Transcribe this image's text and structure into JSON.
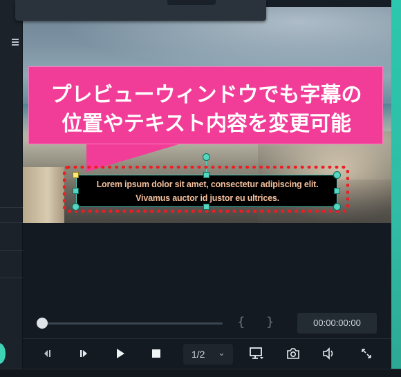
{
  "callout": {
    "line1": "プレビューウィンドウでも字幕の",
    "line2": "位置やテキスト内容を変更可能"
  },
  "subtitle": {
    "line1": "Lorem ipsum dolor sit amet, consectetur adipiscing elit.",
    "line2": "Vivamus auctor id justor eu ultrices."
  },
  "playback": {
    "mark_in": "{",
    "mark_out": "}",
    "timecode": "00:00:00:00",
    "progress": 0,
    "page": "1/2"
  },
  "colors": {
    "callout_bg": "#f23d98",
    "highlight_border": "#ee1c24",
    "handle": "#54d6c1",
    "subtitle_text": "#f6c09d",
    "accent": "#3fd3b6"
  },
  "icons": {
    "left_panel": "menu-lines-icon",
    "controls": [
      "prev-frame-icon",
      "next-frame-icon",
      "play-icon",
      "stop-icon",
      "chevron-down-icon",
      "display-icon",
      "camera-icon",
      "volume-icon",
      "fullscreen-icon"
    ]
  }
}
